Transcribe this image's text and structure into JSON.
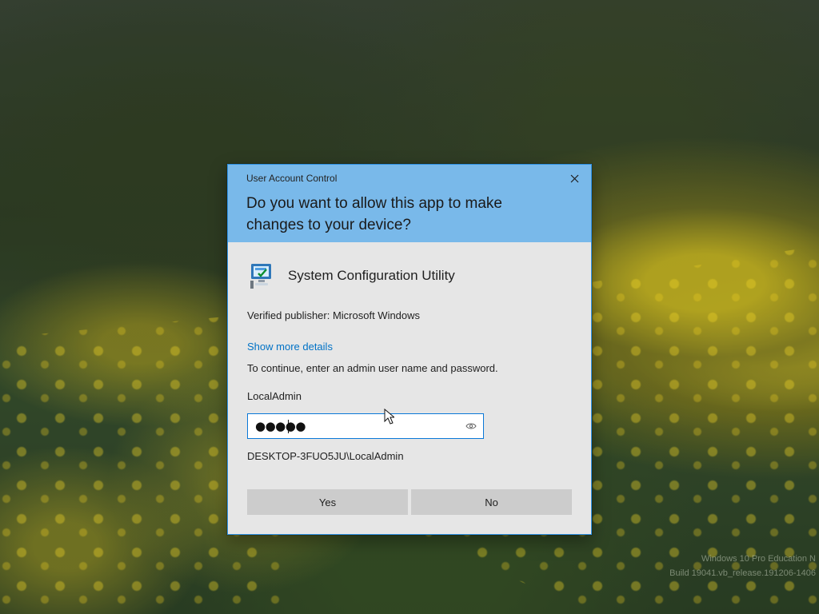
{
  "desktop": {
    "watermark": {
      "edition": "Windows 10 Pro Education N",
      "build": "Build 19041.vb_release.191206-1406"
    }
  },
  "dialog": {
    "title": "User Account Control",
    "question": "Do you want to allow this app to make changes to your device?",
    "app_name": "System Configuration Utility",
    "publisher": "Verified publisher: Microsoft Windows",
    "details_link": "Show more details",
    "continue_text": "To continue, enter an admin user name and password.",
    "username": "LocalAdmin",
    "password_mask": "●●●●●",
    "domain_user": "DESKTOP-3FUO5JU\\LocalAdmin",
    "yes_label": "Yes",
    "no_label": "No",
    "icons": {
      "close": "close-icon",
      "app": "system-configuration-icon",
      "reveal": "eye-icon"
    },
    "colors": {
      "header": "#79b9ea",
      "link": "#0072c6",
      "input_border": "#0a78d7",
      "button": "#cccccc"
    }
  }
}
